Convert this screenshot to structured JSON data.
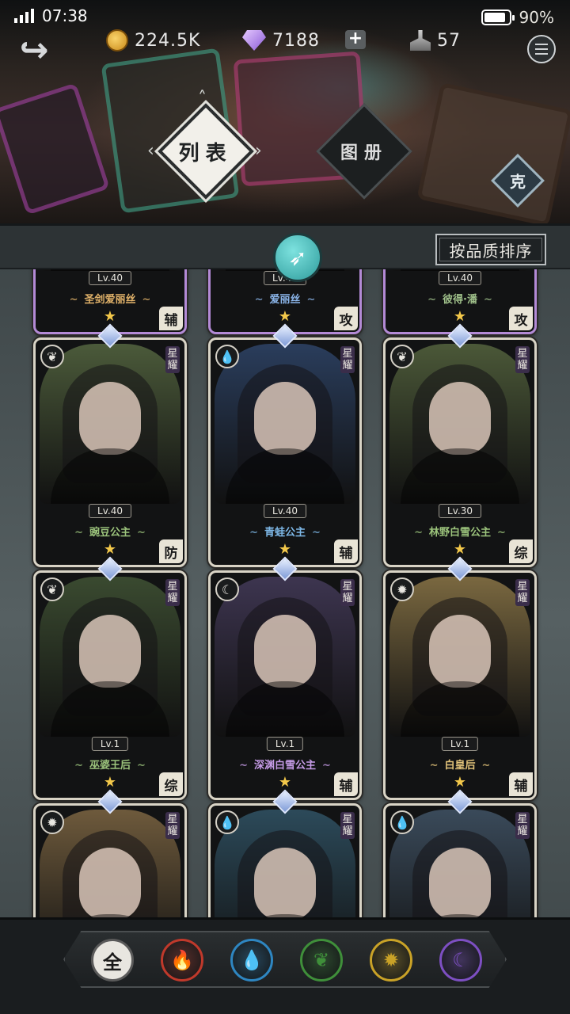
{
  "status": {
    "time": "07:38",
    "battery": "90%"
  },
  "resources": {
    "gold": "224.5K",
    "gems": "7188",
    "plus": "+",
    "ink": "57"
  },
  "tabs": {
    "list": "列表",
    "atlas": "图册"
  },
  "restrain_label": "克",
  "sort_label": "按品质排序",
  "rarity_mark": "星耀",
  "cards": [
    {
      "level": "Lv.40",
      "name": "圣剑爱丽丝",
      "role": "辅",
      "stars": "★",
      "element": "",
      "art": "#7a6a4a",
      "name_color": "#e2b36a",
      "frame": "#b38ad6"
    },
    {
      "level": "Lv.40",
      "name": "爱丽丝",
      "role": "攻",
      "stars": "★",
      "element": "",
      "art": "#2e3a52",
      "name_color": "#8ab4e8",
      "frame": "#b38ad6"
    },
    {
      "level": "Lv.40",
      "name": "彼得·潘",
      "role": "攻",
      "stars": "★",
      "element": "",
      "art": "#3e5038",
      "name_color": "#9fc08a",
      "frame": "#b38ad6"
    },
    {
      "level": "Lv.40",
      "name": "豌豆公主",
      "role": "防",
      "stars": "★",
      "element": "leaf",
      "art": "#4b5a3a",
      "name_color": "#9cc47c",
      "frame": "#d9d4c6"
    },
    {
      "level": "Lv.40",
      "name": "青蛙公主",
      "role": "辅",
      "stars": "★",
      "element": "water",
      "art": "#2a3d5c",
      "name_color": "#7db7e6",
      "frame": "#d9d4c6"
    },
    {
      "level": "Lv.30",
      "name": "林野白雪公主",
      "role": "综",
      "stars": "★",
      "element": "leaf",
      "art": "#4b5838",
      "name_color": "#9cc47c",
      "frame": "#d9d4c6"
    },
    {
      "level": "Lv.1",
      "name": "巫婆王后",
      "role": "综",
      "stars": "★",
      "element": "leaf",
      "art": "#3a4a30",
      "name_color": "#9cc47c",
      "frame": "#d9d4c6"
    },
    {
      "level": "Lv.1",
      "name": "深渊白雪公主",
      "role": "辅",
      "stars": "★",
      "element": "moon",
      "art": "#3d3550",
      "name_color": "#c59be6",
      "frame": "#d9d4c6"
    },
    {
      "level": "Lv.1",
      "name": "白皇后",
      "role": "辅",
      "stars": "★",
      "element": "sun",
      "art": "#7a6840",
      "name_color": "#e3c47a",
      "frame": "#d9d4c6"
    },
    {
      "level": "",
      "name": "",
      "role": "",
      "stars": "",
      "element": "sun",
      "art": "#6e5a3c",
      "name_color": "#e3c47a",
      "frame": "#d9d4c6"
    },
    {
      "level": "",
      "name": "",
      "role": "",
      "stars": "",
      "element": "water",
      "art": "#2c4a5a",
      "name_color": "#7db7e6",
      "frame": "#d9d4c6"
    },
    {
      "level": "",
      "name": "",
      "role": "",
      "stars": "",
      "element": "water",
      "art": "#3a4a5a",
      "name_color": "#7db7e6",
      "frame": "#d9d4c6"
    }
  ],
  "filters": [
    {
      "label": "全",
      "icon": "all-icon",
      "color": "#e8e6e0"
    },
    {
      "label": "",
      "icon": "fire-icon",
      "color": "#c0392b"
    },
    {
      "label": "",
      "icon": "water-icon",
      "color": "#2e86c1"
    },
    {
      "label": "",
      "icon": "leaf-icon",
      "color": "#3f8f3a"
    },
    {
      "label": "",
      "icon": "sun-icon",
      "color": "#c9a227"
    },
    {
      "label": "",
      "icon": "moon-icon",
      "color": "#7d4fc2"
    }
  ]
}
